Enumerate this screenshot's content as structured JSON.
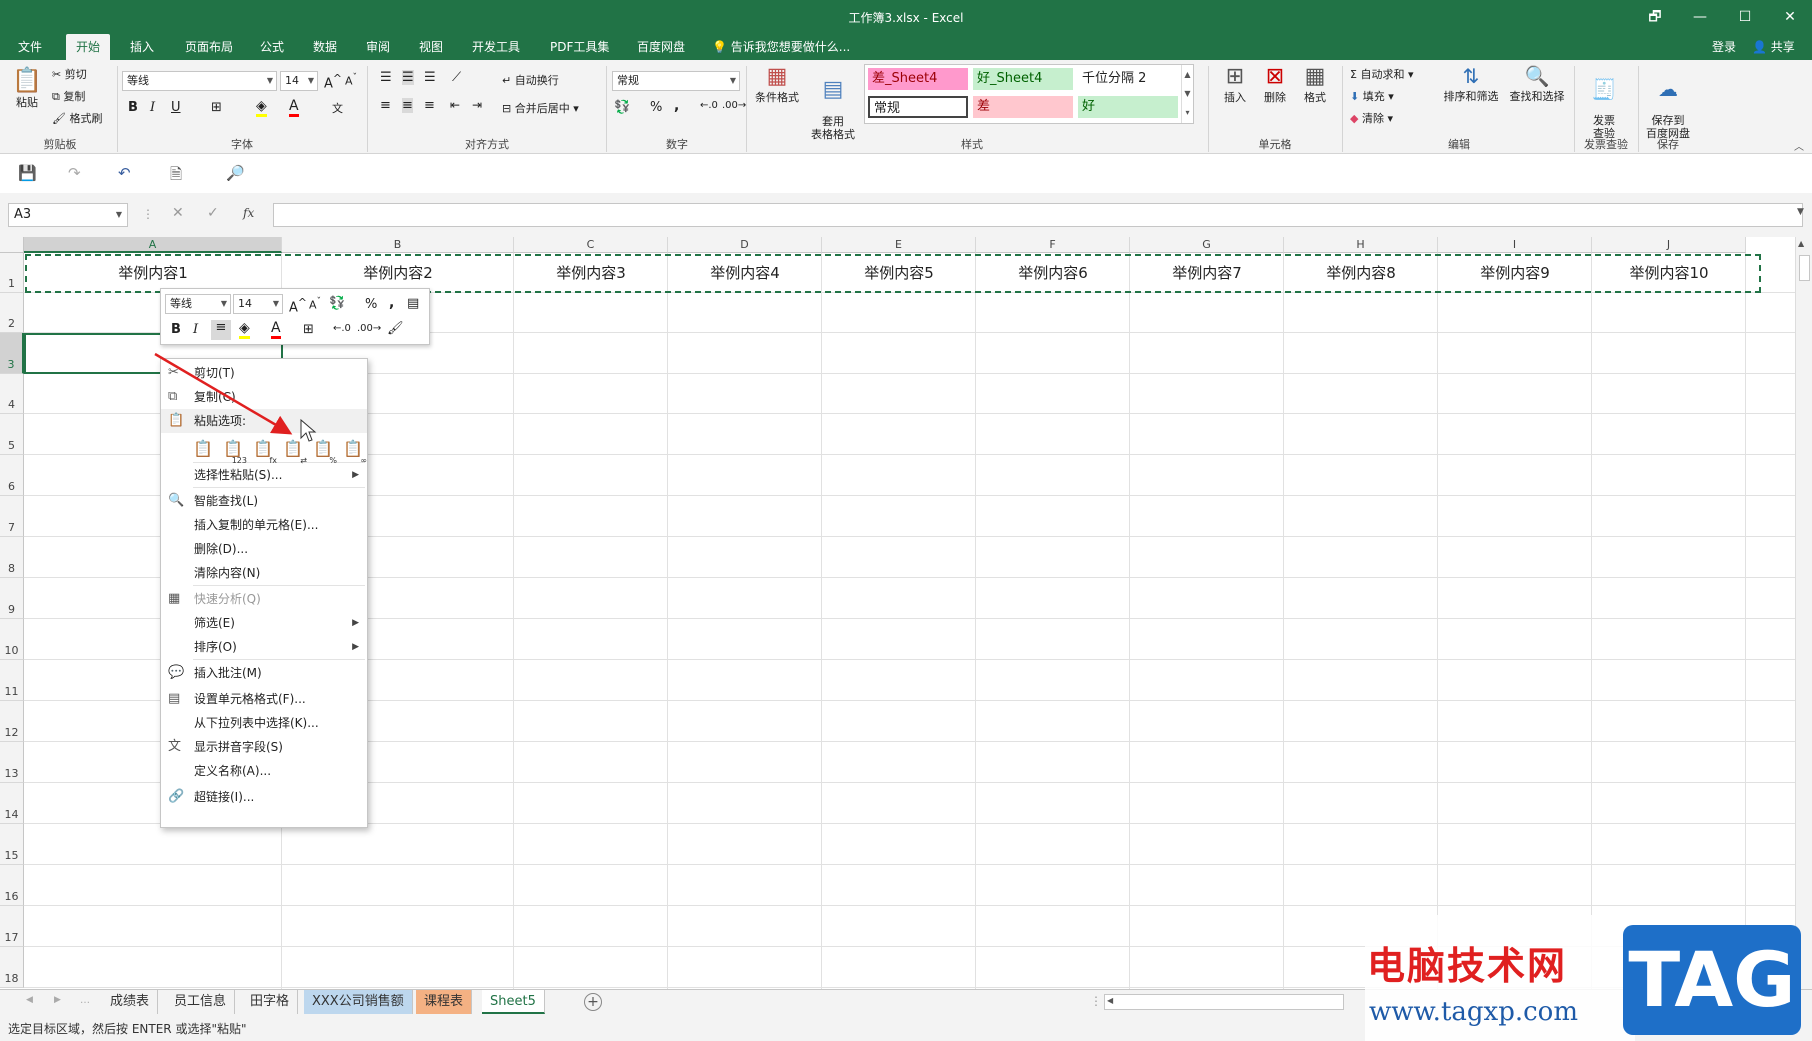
{
  "window": {
    "title": "工作簿3.xlsx - Excel",
    "controls": [
      "🗗",
      "—",
      "☐",
      "✕"
    ]
  },
  "ribbon_tabs": {
    "items": [
      "文件",
      "开始",
      "插入",
      "页面布局",
      "公式",
      "数据",
      "审阅",
      "视图",
      "开发工具",
      "PDF工具集",
      "百度网盘"
    ],
    "active": "开始",
    "tell_me": "告诉我您想要做什么...",
    "login": "登录",
    "share": "共享"
  },
  "ribbon": {
    "clipboard": {
      "paste": "粘贴",
      "cut": "剪切",
      "copy": "复制",
      "format_painter": "格式刷",
      "label": "剪贴板"
    },
    "font": {
      "name": "等线",
      "size": "14",
      "bold": "B",
      "italic": "I",
      "underline": "U",
      "label": "字体"
    },
    "alignment": {
      "wrap": "自动换行",
      "merge": "合并后居中",
      "label": "对齐方式"
    },
    "number": {
      "format": "常规",
      "percent": "%",
      "comma": ",",
      "label": "数字"
    },
    "styles": {
      "conditional": "条件格式",
      "table": "套用\n表格格式",
      "cells": [
        {
          "text": "差_Sheet4",
          "bg": "#ff99cc",
          "fg": "#9c0006"
        },
        {
          "text": "好_Sheet4",
          "bg": "#c6efce",
          "fg": "#006100"
        },
        {
          "text": "千位分隔 2",
          "bg": "#ffffff",
          "fg": "#222222"
        },
        {
          "text": "常规",
          "bg": "#ffffff",
          "fg": "#222222"
        },
        {
          "text": "差",
          "bg": "#ffc7ce",
          "fg": "#9c0006"
        },
        {
          "text": "好",
          "bg": "#c6efce",
          "fg": "#006100"
        }
      ],
      "label": "样式"
    },
    "cells": {
      "insert": "插入",
      "delete": "删除",
      "format": "格式",
      "label": "单元格"
    },
    "editing": {
      "autosum": "自动求和",
      "fill": "填充",
      "clear": "清除",
      "sort": "排序和筛选",
      "find": "查找和选择",
      "label": "编辑"
    },
    "invoice": {
      "check": "发票\n查验",
      "label": "发票查验"
    },
    "save": {
      "save_baidu": "保存到\n百度网盘",
      "label": "保存"
    }
  },
  "formula_bar": {
    "name_box": "A3",
    "fx": "fx",
    "value": ""
  },
  "grid": {
    "columns": [
      "A",
      "B",
      "C",
      "D",
      "E",
      "F",
      "G",
      "H",
      "I",
      "J"
    ],
    "rows": [
      "1",
      "2",
      "3",
      "4",
      "5",
      "6",
      "7",
      "8",
      "9",
      "10",
      "11",
      "12",
      "13",
      "14",
      "15",
      "16",
      "17",
      "18"
    ],
    "row1": [
      "举例内容1",
      "举例内容2",
      "举例内容3",
      "举例内容4",
      "举例内容5",
      "举例内容6",
      "举例内容7",
      "举例内容8",
      "举例内容9",
      "举例内容10"
    ]
  },
  "mini_toolbar": {
    "font": "等线",
    "size": "14",
    "bold": "B",
    "italic": "I"
  },
  "context_menu": {
    "items": [
      {
        "label": "剪切(T)",
        "icon": "✂"
      },
      {
        "label": "复制(C)",
        "icon": "⧉"
      },
      {
        "label": "粘贴选项:",
        "icon": "📋",
        "header": true
      },
      {
        "label": "选择性粘贴(S)...",
        "arrow": true
      },
      {
        "label": "智能查找(L)",
        "icon": "🔍"
      },
      {
        "label": "插入复制的单元格(E)..."
      },
      {
        "label": "删除(D)..."
      },
      {
        "label": "清除内容(N)"
      },
      {
        "label": "快速分析(Q)",
        "disabled": true,
        "icon": "▦"
      },
      {
        "label": "筛选(E)",
        "arrow": true
      },
      {
        "label": "排序(O)",
        "arrow": true
      },
      {
        "label": "插入批注(M)",
        "icon": "💬"
      },
      {
        "label": "设置单元格格式(F)...",
        "icon": "▤"
      },
      {
        "label": "从下拉列表中选择(K)..."
      },
      {
        "label": "显示拼音字段(S)",
        "icon": "文"
      },
      {
        "label": "定义名称(A)..."
      },
      {
        "label": "超链接(I)...",
        "icon": "🔗"
      }
    ]
  },
  "sheet_tabs": [
    {
      "name": "成绩表",
      "bg": "#f3f3f3"
    },
    {
      "name": "员工信息",
      "bg": "#f3f3f3"
    },
    {
      "name": "田字格",
      "bg": "#f3f3f3"
    },
    {
      "name": "XXX公司销售额",
      "bg": "#bdd7ee"
    },
    {
      "name": "课程表",
      "bg": "#f4b183"
    },
    {
      "name": "Sheet5",
      "bg": "#ffffff",
      "active": true
    }
  ],
  "status": {
    "text": "选定目标区域，然后按 ENTER 或选择\"粘贴\""
  },
  "watermark": {
    "title": "电脑技术网",
    "url": "www.tagxp.com",
    "logo": "TAG"
  }
}
